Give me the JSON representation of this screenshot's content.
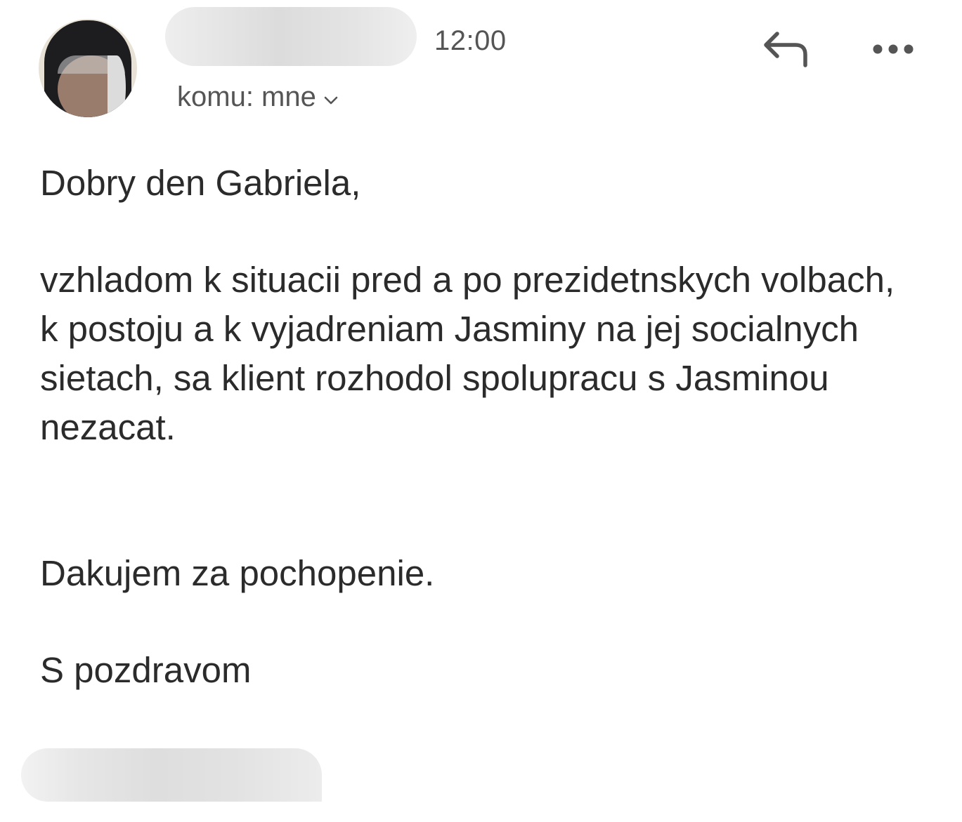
{
  "header": {
    "sender_avatar": "avatar-icon",
    "time": "12:00",
    "recipient_label": "komu: mne",
    "recipient_expand_icon": "chevron-down-icon",
    "reply_icon": "reply-icon",
    "more_icon": "more-horizontal-icon"
  },
  "message": {
    "greeting": "Dobry den Gabriela,",
    "paragraph": "vzhladom k situacii pred a po prezidetnskych volbach, k postoju a k vyjadreniam Jasminy na jej socialnych sietach, sa klient rozhodol spolupracu s Jasminou nezacat.",
    "thanks": "Dakujem za pochopenie.",
    "closing": "S pozdravom"
  },
  "colors": {
    "text": "#2b2b2b",
    "secondary_text": "#555555",
    "background": "#ffffff"
  }
}
